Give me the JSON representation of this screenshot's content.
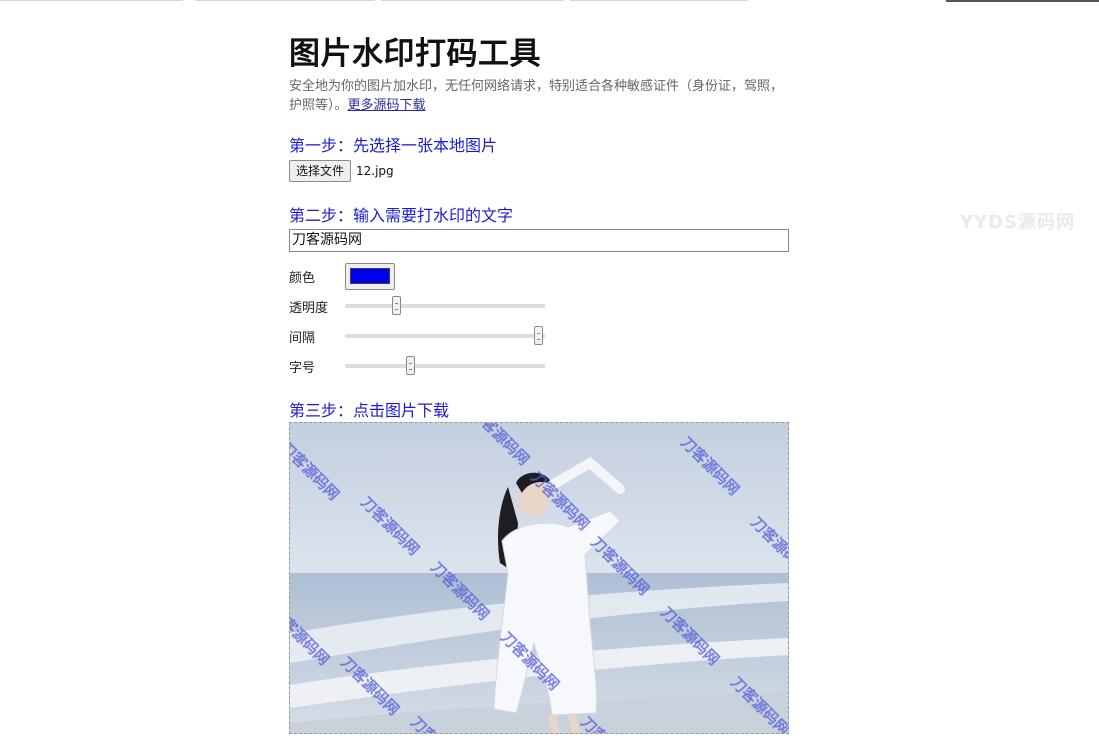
{
  "page": {
    "title": "图片水印打码工具",
    "description": "安全地为你的图片加水印，无任何网络请求，特别适合各种敏感证件（身份证，驾照，护照等）。",
    "more_link": "更多源码下载",
    "corner_watermark": "YYDS源码网"
  },
  "step1": {
    "heading": "第一步：先选择一张本地图片",
    "choose_button": "选择文件",
    "file_name": "12.jpg"
  },
  "step2": {
    "heading": "第二步：输入需要打水印的文字",
    "watermark_text": "刀客源码网",
    "color_label": "颜色",
    "color_value": "#0000ee",
    "opacity_label": "透明度",
    "opacity_fraction": 0.26,
    "spacing_label": "间隔",
    "spacing_fraction": 0.97,
    "fontsize_label": "字号",
    "fontsize_fraction": 0.33
  },
  "step3": {
    "heading": "第三步：点击图片下载",
    "overlay_text": "刀客源码网",
    "overlay_color": "#5660d8"
  }
}
